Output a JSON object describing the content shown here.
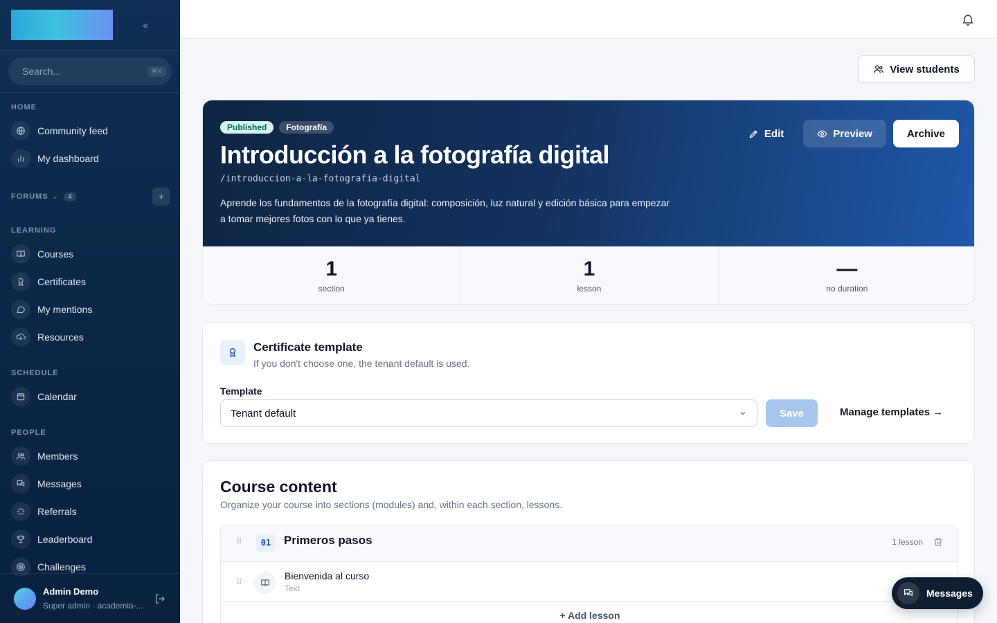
{
  "sidebar": {
    "search_placeholder": "Search...",
    "search_shortcut": "⌘K",
    "sections": {
      "home": "HOME",
      "forums": "FORUMS",
      "forums_count": "4",
      "learning": "LEARNING",
      "schedule": "SCHEDULE",
      "people": "PEOPLE"
    },
    "items": {
      "community_feed": "Community feed",
      "my_dashboard": "My dashboard",
      "courses": "Courses",
      "certificates": "Certificates",
      "my_mentions": "My mentions",
      "resources": "Resources",
      "calendar": "Calendar",
      "members": "Members",
      "messages": "Messages",
      "referrals": "Referrals",
      "leaderboard": "Leaderboard",
      "challenges": "Challenges"
    },
    "user": {
      "name": "Admin Demo",
      "role": "Super admin · academia-..."
    }
  },
  "header": {
    "view_students": "View students"
  },
  "course": {
    "status": "Published",
    "category": "Fotografía",
    "title": "Introducción a la fotografía digital",
    "slug": "/introduccion-a-la-fotografia-digital",
    "description": "Aprende los fundamentos de la fotografía digital: composición, luz natural y edición básica para empezar a tomar mejores fotos con lo que ya tienes.",
    "actions": {
      "edit": "Edit",
      "preview": "Preview",
      "archive": "Archive"
    },
    "stats": [
      {
        "value": "1",
        "label": "section"
      },
      {
        "value": "1",
        "label": "lesson"
      },
      {
        "value": "—",
        "label": "no duration"
      }
    ]
  },
  "certificate": {
    "title": "Certificate template",
    "subtitle": "If you don't choose one, the tenant default is used.",
    "template_label": "Template",
    "selected": "Tenant default",
    "save": "Save",
    "manage": "Manage templates →"
  },
  "content": {
    "title": "Course content",
    "subtitle": "Organize your course into sections (modules) and, within each section, lessons.",
    "sections": [
      {
        "number": "01",
        "name": "Primeros pasos",
        "count": "1 lesson",
        "lessons": [
          {
            "name": "Bienvenida al curso",
            "type": "Text"
          }
        ]
      }
    ],
    "add_lesson": "Add lesson"
  },
  "fab": {
    "messages": "Messages"
  }
}
